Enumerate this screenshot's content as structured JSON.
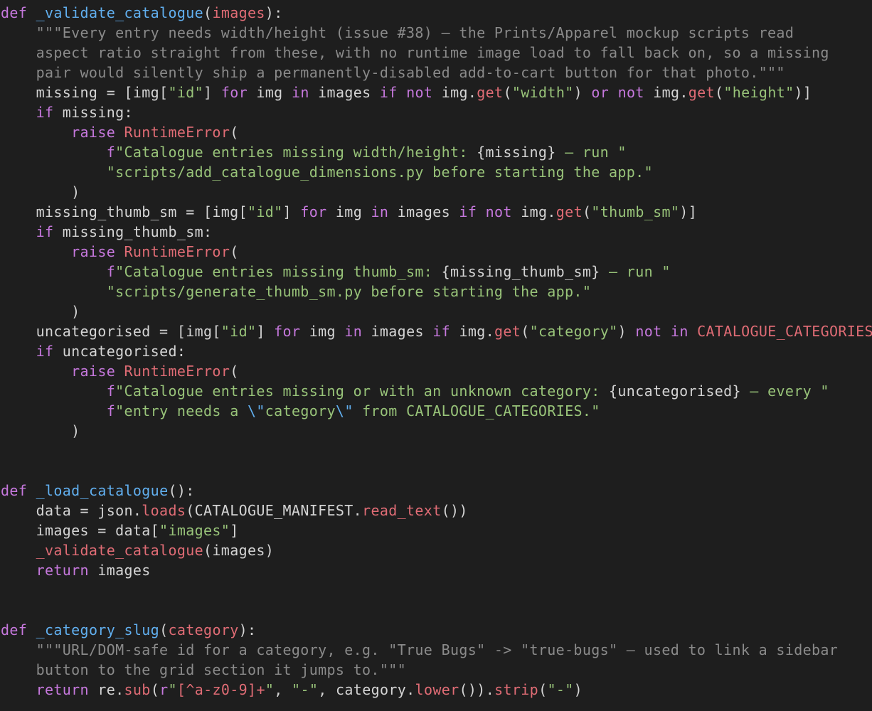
{
  "editor": {
    "language": "python",
    "colors": {
      "background": "#1e1e1e",
      "keyword": "#c678dd",
      "function": "#61afef",
      "string": "#98c379",
      "docstring": "#8a8a8a",
      "call": "#e06c75",
      "plain": "#d4d4d4"
    },
    "lines": [
      {
        "tokens": [
          {
            "t": "def",
            "c": "kw"
          },
          {
            "t": " "
          },
          {
            "t": "_validate_catalogue",
            "c": "fn"
          },
          {
            "t": "("
          },
          {
            "t": "images",
            "c": "param"
          },
          {
            "t": "):"
          }
        ]
      },
      {
        "tokens": [
          {
            "t": "    "
          },
          {
            "t": "\"\"\"Every entry needs width/height (issue #38) — the Prints/Apparel mockup scripts read",
            "c": "doc"
          }
        ]
      },
      {
        "tokens": [
          {
            "t": "    "
          },
          {
            "t": "aspect ratio straight from these, with no runtime image load to fall back on, so a missing",
            "c": "doc"
          }
        ]
      },
      {
        "tokens": [
          {
            "t": "    "
          },
          {
            "t": "pair would silently ship a permanently-disabled add-to-cart button for that photo.\"\"\"",
            "c": "doc"
          }
        ]
      },
      {
        "tokens": [
          {
            "t": "    missing = [img["
          },
          {
            "t": "\"id\"",
            "c": "str"
          },
          {
            "t": "] "
          },
          {
            "t": "for",
            "c": "kw"
          },
          {
            "t": " img "
          },
          {
            "t": "in",
            "c": "kw"
          },
          {
            "t": " images "
          },
          {
            "t": "if",
            "c": "kw"
          },
          {
            "t": " "
          },
          {
            "t": "not",
            "c": "kw"
          },
          {
            "t": " img."
          },
          {
            "t": "get",
            "c": "call"
          },
          {
            "t": "("
          },
          {
            "t": "\"width\"",
            "c": "str"
          },
          {
            "t": ") "
          },
          {
            "t": "or",
            "c": "kw"
          },
          {
            "t": " "
          },
          {
            "t": "not",
            "c": "kw"
          },
          {
            "t": " img."
          },
          {
            "t": "get",
            "c": "call"
          },
          {
            "t": "("
          },
          {
            "t": "\"height\"",
            "c": "str"
          },
          {
            "t": ")]"
          }
        ]
      },
      {
        "tokens": [
          {
            "t": "    "
          },
          {
            "t": "if",
            "c": "kw"
          },
          {
            "t": " missing:"
          }
        ]
      },
      {
        "tokens": [
          {
            "t": "        "
          },
          {
            "t": "raise",
            "c": "kw"
          },
          {
            "t": " "
          },
          {
            "t": "RuntimeError",
            "c": "cls"
          },
          {
            "t": "("
          }
        ]
      },
      {
        "tokens": [
          {
            "t": "            "
          },
          {
            "t": "f",
            "c": "kw"
          },
          {
            "t": "\"Catalogue entries missing width/height: ",
            "c": "str"
          },
          {
            "t": "{missing}"
          },
          {
            "t": " — run \"",
            "c": "str"
          }
        ]
      },
      {
        "tokens": [
          {
            "t": "            "
          },
          {
            "t": "\"scripts/add_catalogue_dimensions.py before starting the app.\"",
            "c": "str"
          }
        ]
      },
      {
        "tokens": [
          {
            "t": "        )"
          }
        ]
      },
      {
        "tokens": [
          {
            "t": "    missing_thumb_sm = [img["
          },
          {
            "t": "\"id\"",
            "c": "str"
          },
          {
            "t": "] "
          },
          {
            "t": "for",
            "c": "kw"
          },
          {
            "t": " img "
          },
          {
            "t": "in",
            "c": "kw"
          },
          {
            "t": " images "
          },
          {
            "t": "if",
            "c": "kw"
          },
          {
            "t": " "
          },
          {
            "t": "not",
            "c": "kw"
          },
          {
            "t": " img."
          },
          {
            "t": "get",
            "c": "call"
          },
          {
            "t": "("
          },
          {
            "t": "\"thumb_sm\"",
            "c": "str"
          },
          {
            "t": ")]"
          }
        ]
      },
      {
        "tokens": [
          {
            "t": "    "
          },
          {
            "t": "if",
            "c": "kw"
          },
          {
            "t": " missing_thumb_sm:"
          }
        ]
      },
      {
        "tokens": [
          {
            "t": "        "
          },
          {
            "t": "raise",
            "c": "kw"
          },
          {
            "t": " "
          },
          {
            "t": "RuntimeError",
            "c": "cls"
          },
          {
            "t": "("
          }
        ]
      },
      {
        "tokens": [
          {
            "t": "            "
          },
          {
            "t": "f",
            "c": "kw"
          },
          {
            "t": "\"Catalogue entries missing thumb_sm: ",
            "c": "str"
          },
          {
            "t": "{missing_thumb_sm}"
          },
          {
            "t": " — run \"",
            "c": "str"
          }
        ]
      },
      {
        "tokens": [
          {
            "t": "            "
          },
          {
            "t": "\"scripts/generate_thumb_sm.py before starting the app.\"",
            "c": "str"
          }
        ]
      },
      {
        "tokens": [
          {
            "t": "        )"
          }
        ]
      },
      {
        "tokens": [
          {
            "t": "    uncategorised = [img["
          },
          {
            "t": "\"id\"",
            "c": "str"
          },
          {
            "t": "] "
          },
          {
            "t": "for",
            "c": "kw"
          },
          {
            "t": " img "
          },
          {
            "t": "in",
            "c": "kw"
          },
          {
            "t": " images "
          },
          {
            "t": "if",
            "c": "kw"
          },
          {
            "t": " img."
          },
          {
            "t": "get",
            "c": "call"
          },
          {
            "t": "("
          },
          {
            "t": "\"category\"",
            "c": "str"
          },
          {
            "t": ") "
          },
          {
            "t": "not",
            "c": "kw"
          },
          {
            "t": " "
          },
          {
            "t": "in",
            "c": "kw"
          },
          {
            "t": " "
          },
          {
            "t": "CATALOGUE_CATEGORIES",
            "c": "const"
          },
          {
            "t": "]"
          }
        ]
      },
      {
        "tokens": [
          {
            "t": "    "
          },
          {
            "t": "if",
            "c": "kw"
          },
          {
            "t": " uncategorised:"
          }
        ]
      },
      {
        "tokens": [
          {
            "t": "        "
          },
          {
            "t": "raise",
            "c": "kw"
          },
          {
            "t": " "
          },
          {
            "t": "RuntimeError",
            "c": "cls"
          },
          {
            "t": "("
          }
        ]
      },
      {
        "tokens": [
          {
            "t": "            "
          },
          {
            "t": "f",
            "c": "kw"
          },
          {
            "t": "\"Catalogue entries missing or with an unknown category: ",
            "c": "str"
          },
          {
            "t": "{uncategorised}"
          },
          {
            "t": " — every \"",
            "c": "str"
          }
        ]
      },
      {
        "tokens": [
          {
            "t": "            "
          },
          {
            "t": "f",
            "c": "kw"
          },
          {
            "t": "\"entry needs a ",
            "c": "str"
          },
          {
            "t": "\\\"",
            "c": "fn"
          },
          {
            "t": "category",
            "c": "str"
          },
          {
            "t": "\\\"",
            "c": "fn"
          },
          {
            "t": " from CATALOGUE_CATEGORIES.\"",
            "c": "str"
          }
        ]
      },
      {
        "tokens": [
          {
            "t": "        )"
          }
        ]
      },
      {
        "tokens": []
      },
      {
        "tokens": []
      },
      {
        "tokens": [
          {
            "t": "def",
            "c": "kw"
          },
          {
            "t": " "
          },
          {
            "t": "_load_catalogue",
            "c": "fn"
          },
          {
            "t": "():"
          }
        ]
      },
      {
        "tokens": [
          {
            "t": "    data = json."
          },
          {
            "t": "loads",
            "c": "call"
          },
          {
            "t": "(CATALOGUE_MANIFEST."
          },
          {
            "t": "read_text",
            "c": "call"
          },
          {
            "t": "())"
          }
        ]
      },
      {
        "tokens": [
          {
            "t": "    images = data["
          },
          {
            "t": "\"images\"",
            "c": "str"
          },
          {
            "t": "]"
          }
        ]
      },
      {
        "tokens": [
          {
            "t": "    "
          },
          {
            "t": "_validate_catalogue",
            "c": "call"
          },
          {
            "t": "(images)"
          }
        ]
      },
      {
        "tokens": [
          {
            "t": "    "
          },
          {
            "t": "return",
            "c": "kw"
          },
          {
            "t": " images"
          }
        ]
      },
      {
        "tokens": []
      },
      {
        "tokens": []
      },
      {
        "tokens": [
          {
            "t": "def",
            "c": "kw"
          },
          {
            "t": " "
          },
          {
            "t": "_category_slug",
            "c": "fn"
          },
          {
            "t": "("
          },
          {
            "t": "category",
            "c": "param"
          },
          {
            "t": "):"
          }
        ]
      },
      {
        "tokens": [
          {
            "t": "    "
          },
          {
            "t": "\"\"\"URL/DOM-safe id for a category, e.g. \"True Bugs\" -> \"true-bugs\" — used to link a sidebar",
            "c": "doc"
          }
        ]
      },
      {
        "tokens": [
          {
            "t": "    "
          },
          {
            "t": "button to the grid section it jumps to.\"\"\"",
            "c": "doc"
          }
        ]
      },
      {
        "tokens": [
          {
            "t": "    "
          },
          {
            "t": "return",
            "c": "kw"
          },
          {
            "t": " re."
          },
          {
            "t": "sub",
            "c": "call"
          },
          {
            "t": "("
          },
          {
            "t": "r",
            "c": "kw"
          },
          {
            "t": "\"",
            "c": "str"
          },
          {
            "t": "[^a-z0-9]+",
            "c": "call"
          },
          {
            "t": "\"",
            "c": "str"
          },
          {
            "t": ", "
          },
          {
            "t": "\"-\"",
            "c": "str"
          },
          {
            "t": ", category."
          },
          {
            "t": "lower",
            "c": "call"
          },
          {
            "t": "())."
          },
          {
            "t": "strip",
            "c": "call"
          },
          {
            "t": "("
          },
          {
            "t": "\"-\"",
            "c": "str"
          },
          {
            "t": ")"
          }
        ]
      }
    ]
  }
}
